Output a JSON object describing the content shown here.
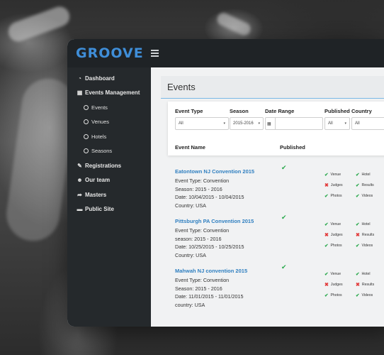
{
  "app": {
    "logo": "GROOVE"
  },
  "sidebar": {
    "items": [
      {
        "label": "Dashboard",
        "icon": "dashboard-icon",
        "glyph": "◔"
      },
      {
        "label": "Events Management",
        "icon": "calendar-icon",
        "glyph": "▦"
      },
      {
        "label": "Events",
        "sub": true
      },
      {
        "label": "Venues",
        "sub": true
      },
      {
        "label": "Hotels",
        "sub": true
      },
      {
        "label": "Seasons",
        "sub": true
      },
      {
        "label": "Registrations",
        "icon": "edit-icon",
        "glyph": "✎"
      },
      {
        "label": "Our team",
        "icon": "users-icon",
        "glyph": "☻"
      },
      {
        "label": "Masters",
        "icon": "share-icon",
        "glyph": "➦"
      },
      {
        "label": "Public Site",
        "icon": "folder-icon",
        "glyph": "▬"
      }
    ]
  },
  "page": {
    "title": "Events"
  },
  "filters": {
    "event_type": {
      "label": "Event Type",
      "value": "All"
    },
    "season": {
      "label": "Season",
      "value": "2015-2016"
    },
    "date_range": {
      "label": "Date Range",
      "value": ""
    },
    "published": {
      "label": "Published",
      "value": "All"
    },
    "country": {
      "label": "Country",
      "value": "All"
    }
  },
  "table": {
    "col_event_name": "Event Name",
    "col_published": "Published"
  },
  "events": [
    {
      "name": "Eatontown NJ Convention 2015",
      "lines": [
        "Event Type: Convention",
        "Season: 2015 - 2016",
        "Date: 10/04/2015 - 10/04/2015",
        "Country: USA"
      ],
      "published": true,
      "checks": {
        "venue": true,
        "hotel": true,
        "judges": false,
        "results": true,
        "photos": true,
        "videos": true
      }
    },
    {
      "name": "Pittsburgh PA Convention 2015",
      "lines": [
        "Event Type: Convention",
        "season: 2015 - 2016",
        "Date: 10/25/2015 - 10/25/2015",
        "Country: USA"
      ],
      "published": true,
      "checks": {
        "venue": true,
        "hotel": true,
        "judges": false,
        "results": false,
        "photos": true,
        "videos": true
      }
    },
    {
      "name": "Mahwah NJ convention 2015",
      "lines": [
        "Event Type: Convention",
        "Season: 2015 - 2016",
        "Date: 11/01/2015 - 11/01/2015",
        "country: USA"
      ],
      "published": true,
      "checks": {
        "venue": true,
        "hotel": true,
        "judges": false,
        "results": false,
        "photos": true,
        "videos": true
      }
    }
  ],
  "check_labels": {
    "venue": "Venue",
    "hotel": "Hotel",
    "judges": "Judges",
    "results": "Results",
    "photos": "Photos",
    "videos": "Videos"
  },
  "colors": {
    "accent": "#3f8ed8",
    "link": "#2f7fc0",
    "ok": "#27a84a",
    "bad": "#e23b3b",
    "sidebar": "#25292c"
  }
}
